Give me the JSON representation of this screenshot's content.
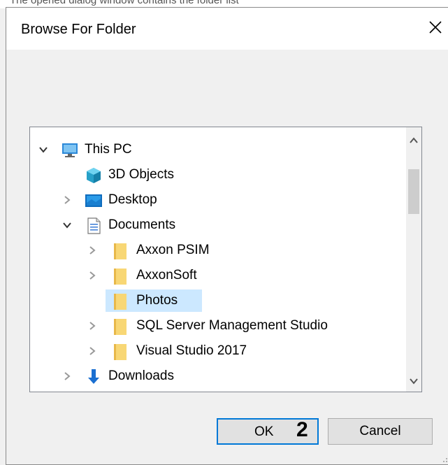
{
  "background_text": "The opened dialog window contains the folder list",
  "dialog": {
    "title": "Browse For Folder",
    "close_glyph": "✕"
  },
  "tree": {
    "items": [
      {
        "label": "This PC",
        "expander": "expanded",
        "icon": "computer-icon"
      },
      {
        "label": "3D Objects",
        "expander": "none",
        "icon": "3d-objects-icon"
      },
      {
        "label": "Desktop",
        "expander": "collapsed",
        "icon": "desktop-icon"
      },
      {
        "label": "Documents",
        "expander": "expanded",
        "icon": "documents-icon"
      },
      {
        "label": "Axxon PSIM",
        "expander": "collapsed",
        "icon": "folder-icon"
      },
      {
        "label": "AxxonSoft",
        "expander": "collapsed",
        "icon": "folder-icon"
      },
      {
        "label": "Photos",
        "expander": "none",
        "icon": "folder-icon",
        "selected": true
      },
      {
        "label": "SQL Server Management Studio",
        "expander": "collapsed",
        "icon": "folder-icon"
      },
      {
        "label": "Visual Studio 2017",
        "expander": "collapsed",
        "icon": "folder-icon"
      },
      {
        "label": "Downloads",
        "expander": "collapsed",
        "icon": "downloads-icon"
      }
    ]
  },
  "buttons": {
    "ok": "OK",
    "cancel": "Cancel"
  },
  "annotation": "2",
  "colors": {
    "selection": "#cce8ff",
    "accent": "#0078d7",
    "folder": "#f8d775"
  }
}
